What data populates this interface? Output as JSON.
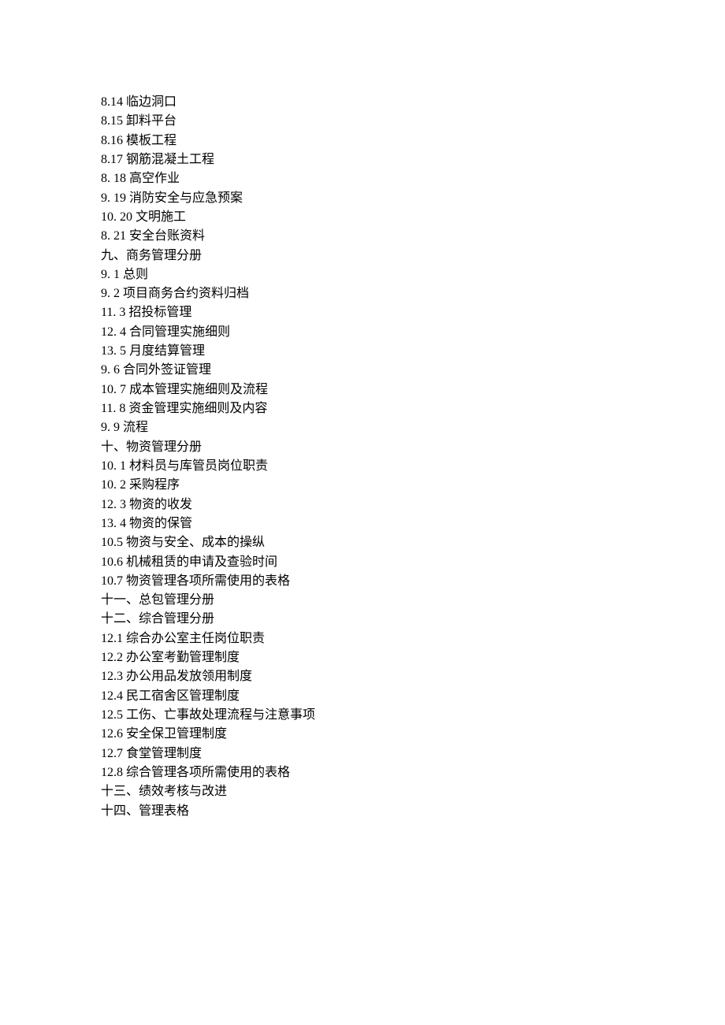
{
  "lines": [
    "8.14 临边洞口",
    "8.15 卸料平台",
    "8.16 模板工程",
    "8.17 钢筋混凝土工程",
    "8.   18 高空作业",
    "9.   19 消防安全与应急预案",
    "10. 20 文明施工",
    "8.   21 安全台账资料",
    "九、商务管理分册",
    "9.   1 总则",
    "9.   2 项目商务合约资料归档",
    "11. 3 招投标管理",
    "12. 4 合同管理实施细则",
    "13. 5 月度结算管理",
    "9.   6 合同外签证管理",
    "10. 7 成本管理实施细则及流程",
    "11. 8 资金管理实施细则及内容",
    "9.   9 流程",
    "十、物资管理分册",
    "10.   1 材料员与库管员岗位职责",
    "10.   2 采购程序",
    "12.   3 物资的收发",
    "13.   4 物资的保管",
    "10.5 物资与安全、成本的操纵",
    "10.6 机械租赁的申请及查验时间",
    "10.7 物资管理各项所需使用的表格",
    "十一、总包管理分册",
    "十二、综合管理分册",
    "12.1 综合办公室主任岗位职责",
    "12.2 办公室考勤管理制度",
    "12.3 办公用品发放领用制度",
    "12.4 民工宿舍区管理制度",
    "12.5 工伤、亡事故处理流程与注意事项",
    "12.6 安全保卫管理制度",
    "12.7 食堂管理制度",
    "12.8 综合管理各项所需使用的表格",
    "十三、绩效考核与改进",
    "十四、管理表格"
  ]
}
